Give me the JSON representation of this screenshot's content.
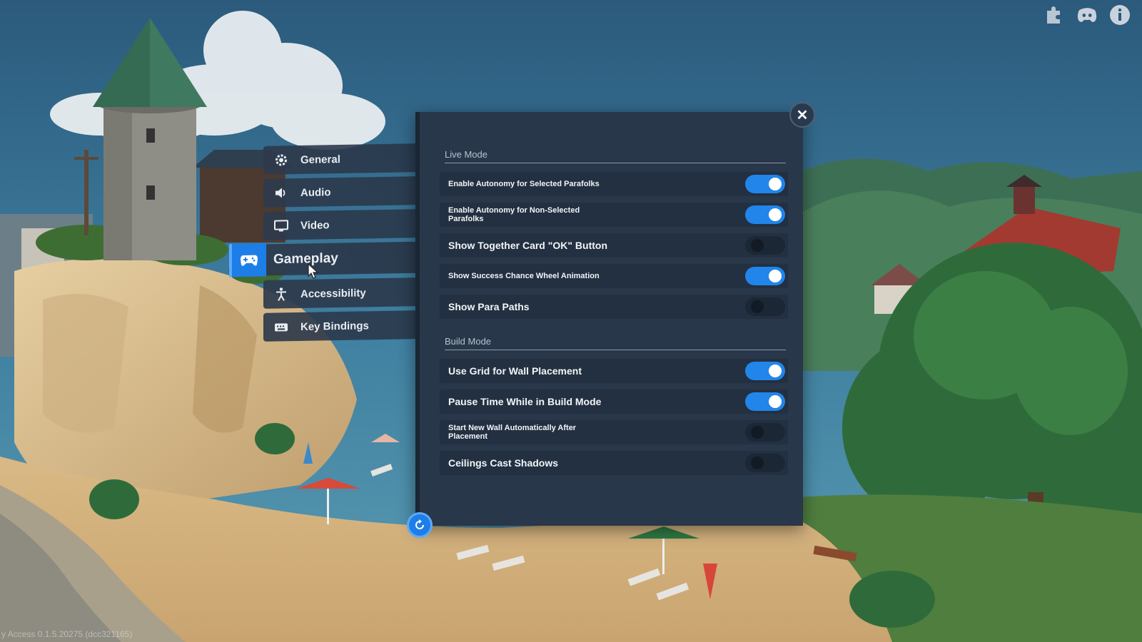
{
  "menu": {
    "items": [
      {
        "label": "General",
        "icon": "gear-icon"
      },
      {
        "label": "Audio",
        "icon": "speaker-icon"
      },
      {
        "label": "Video",
        "icon": "monitor-icon"
      },
      {
        "label": "Gameplay",
        "icon": "gamepad-icon",
        "active": true
      },
      {
        "label": "Accessibility",
        "icon": "accessibility-icon"
      },
      {
        "label": "Key Bindings",
        "icon": "keyboard-icon"
      }
    ]
  },
  "live_mode": {
    "title": "Live Mode",
    "settings": [
      {
        "label": "Enable Autonomy for Selected Parafolks",
        "on": true
      },
      {
        "label": "Enable Autonomy for Non-Selected Parafolks",
        "on": true
      },
      {
        "label": "Show Together Card \"OK\" Button",
        "on": false
      },
      {
        "label": "Show Success Chance Wheel Animation",
        "on": true
      },
      {
        "label": "Show Para Paths",
        "on": false
      }
    ]
  },
  "build_mode": {
    "title": "Build Mode",
    "settings": [
      {
        "label": "Use Grid for Wall Placement",
        "on": true
      },
      {
        "label": "Pause Time While in Build Mode",
        "on": true
      },
      {
        "label": "Start New Wall Automatically After Placement",
        "on": false
      },
      {
        "label": "Ceilings Cast Shadows",
        "on": false
      }
    ]
  },
  "close_label": "✕",
  "top_icons": [
    "puzzle-icon",
    "discord-icon",
    "info-icon"
  ],
  "version": "y Access 0.1.5.20275 (dcc321165)",
  "colors": {
    "accent": "#2185ea",
    "panel": "#283749",
    "row": "#223041"
  }
}
